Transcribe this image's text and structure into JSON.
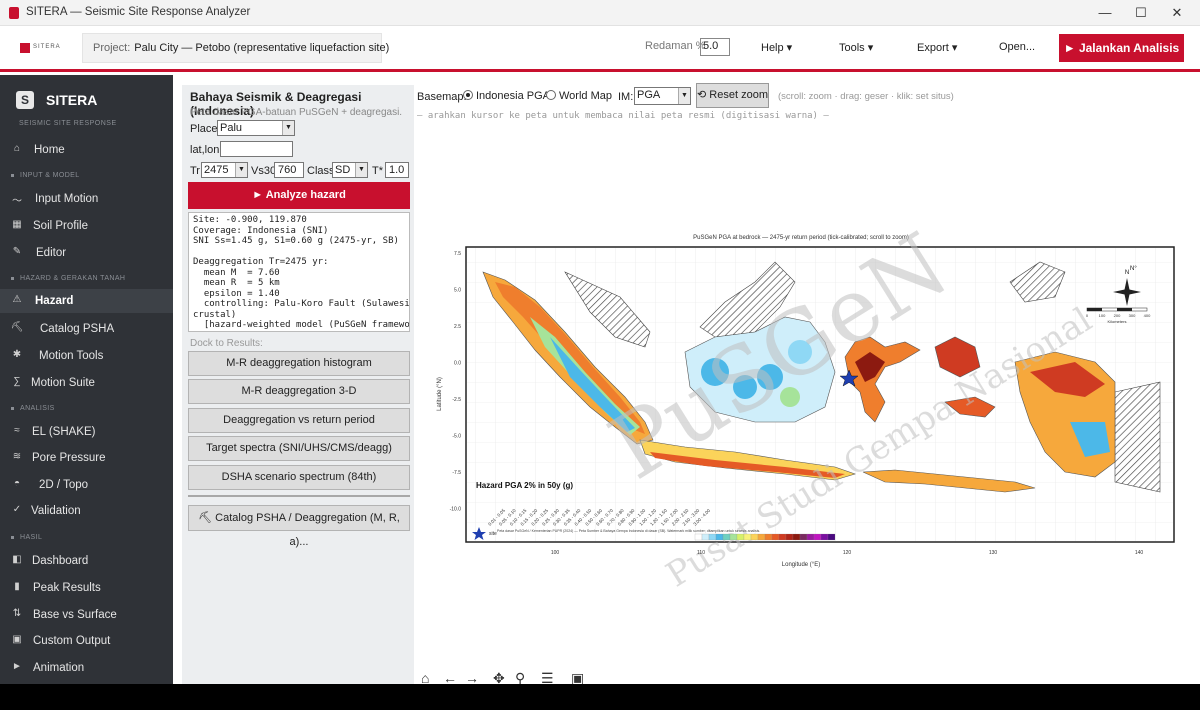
{
  "window": {
    "title": "SITERA — Seismic Site Response Analyzer",
    "minimize": "—",
    "maximize": "☐",
    "close": "✕"
  },
  "header": {
    "logo_text": "SITERA",
    "project_label": "Project:",
    "project_value": "Palu City — Petobo (representative liquefaction site)",
    "redaman_label": "Redaman %",
    "redaman_value": "5.0",
    "menus": [
      "Help ▾",
      "Tools ▾",
      "Export ▾",
      "Open..."
    ],
    "run_button": "► Jalankan Analisis"
  },
  "sidebar": {
    "brand": "SITERA",
    "subtitle": "SEISMIC SITE RESPONSE",
    "home": "Home",
    "sections": [
      "INPUT & MODEL",
      "HAZARD & GERAKAN TANAH",
      "ANALISIS",
      "HASIL"
    ],
    "items": [
      {
        "label": "Input Motion",
        "icon": "〜"
      },
      {
        "label": "Soil Profile",
        "icon": "▦"
      },
      {
        "label": "Editor",
        "icon": "✎"
      },
      {
        "label": "Hazard",
        "icon": "⚠"
      },
      {
        "label": "Catalog PSHA",
        "icon": "⛏"
      },
      {
        "label": "Motion Tools",
        "icon": "✱"
      },
      {
        "label": "Motion Suite",
        "icon": "∑"
      },
      {
        "label": "EL (SHAKE)",
        "icon": "≈"
      },
      {
        "label": "Pore Pressure",
        "icon": "≋"
      },
      {
        "label": "2D / Topo",
        "icon": "◓"
      },
      {
        "label": "Validation",
        "icon": "✓"
      },
      {
        "label": "Dashboard",
        "icon": "◧"
      },
      {
        "label": "Peak Results",
        "icon": "▮"
      },
      {
        "label": "Base vs Surface",
        "icon": "⇅"
      },
      {
        "label": "Custom Output",
        "icon": "▣"
      },
      {
        "label": "Animation",
        "icon": "►"
      }
    ]
  },
  "panel": {
    "title": "Bahaya Seismik & Deagregasi (Indonesia)",
    "subtitle": "Peta dasar PGA-batuan PuSGeN + deagregasi.",
    "place_label": "Place",
    "place_value": "Palu",
    "latlon_label": "lat,lon",
    "latlon_value": "",
    "tr_label": "Tr",
    "tr_value": "2475",
    "vs30_label": "Vs30",
    "vs30_value": "760",
    "class_label": "Class",
    "class_value": "SD",
    "tstar_label": "T*",
    "tstar_value": "1.0",
    "analyze_button": "► Analyze hazard",
    "output": "Site: -0.900, 119.870\nCoverage: Indonesia (SNI)\nSNI Ss=1.45 g, S1=0.60 g (2475-yr, SB)\n\nDeaggregation Tr=2475 yr:\n  mean M  = 7.60\n  mean R  = 5 km\n  epsilon = 1.40\n  controlling: Palu-Koro Fault (Sulawesi,\ncrustal)\n  [hazard-weighted model (PuSGeN framework)]",
    "dock_label": "Dock to Results:",
    "buttons": [
      "M-R deaggregation histogram",
      "M-R deaggregation 3-D",
      "Deaggregation vs return period",
      "Target spectra (SNI/UHS/CMS/deagg)",
      "DSHA scenario spectrum (84th)"
    ],
    "catalog_button": "⛏ Catalog PSHA / Deaggregation (M, R, a)..."
  },
  "map_toolbar": {
    "basemap_label": "Basemap:",
    "basemap_options": [
      "Indonesia PGA",
      "World Map"
    ],
    "basemap_selected": "Indonesia PGA",
    "im_label": "IM:",
    "im_value": "PGA",
    "reset_button": "⟲ Reset zoom",
    "hint": "(scroll: zoom · drag: geser · klik: set situs)",
    "cursor_hint": "— arahkan kursor ke peta untuk membaca nilai peta resmi (digitisasi warna) —"
  },
  "map": {
    "title": "PuSGeN PGA at bedrock — 2475-yr return period (tick-calibrated; scroll to zoom)",
    "yticks": [
      "7.5",
      "5.0",
      "2.5",
      "0.0",
      "-2.5",
      "-5.0",
      "-7.5",
      "-10.0"
    ],
    "xticks": [
      "100",
      "110",
      "120",
      "130",
      "140"
    ],
    "xlabel": "Longitude (°E)",
    "ylabel": "Latitude (°N)",
    "inset_label": "Hazard PGA 2% in 50y (g)",
    "legend_ranges": [
      "0.01 - 0.05",
      "0.05 - 0.10",
      "0.10 - 0.15",
      "0.15 - 0.20",
      "0.20 - 0.25",
      "0.25 - 0.30",
      "0.30 - 0.35",
      "0.35 - 0.40",
      "0.40 - 0.50",
      "0.50 - 0.60",
      "0.60 - 0.70",
      "0.70 - 0.80",
      "0.80 - 0.90",
      "0.90 - 1.00",
      "1.00 - 1.20",
      "1.20 - 1.50",
      "1.50 - 2.00",
      "2.00 - 2.50",
      "2.50 - 3.00",
      "3.00 - 4.00"
    ],
    "legend_colors": [
      "#ffffff",
      "#cfeefa",
      "#8fd8f5",
      "#4cb8e8",
      "#6fd0c0",
      "#a6e39a",
      "#d7f06a",
      "#f7f27a",
      "#fbd35a",
      "#f6a83c",
      "#ef7e2d",
      "#e55a26",
      "#cf3b22",
      "#b02518",
      "#8c1a10",
      "#7a2a60",
      "#9a1aa0",
      "#c015c0",
      "#7a10a0",
      "#4a0a80"
    ],
    "credit": "Peta dasar PuSGeN / Kementerian PUPR (2024) — Peta Sumber & Bahaya Gempa Indonesia di dasar (SB). Watermark milik sumber; ditampilkan untuk sintesis analisis.",
    "site_label": "site",
    "watermark_main": "PuSGeN",
    "watermark_sub": "Pusat Studi Gempa Nasional",
    "north_label": "N",
    "scalebar_label": "Kilometers",
    "scalebar_ticks": [
      "0",
      "100",
      "200",
      "300",
      "400"
    ],
    "corner_label": "N°",
    "colors": {
      "ocean": "#ffffff",
      "site_star": "#1f3fb0"
    }
  }
}
